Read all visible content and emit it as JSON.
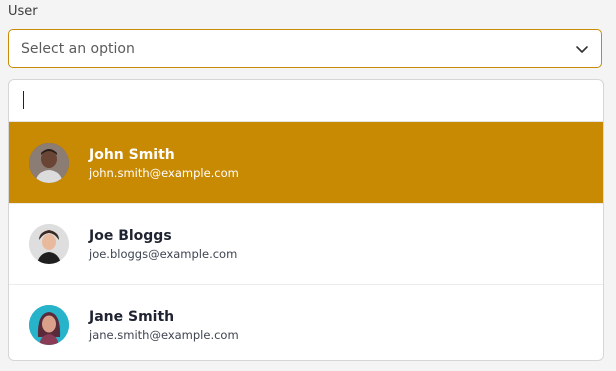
{
  "field": {
    "label": "User",
    "placeholder": "Select an option"
  },
  "search": {
    "value": ""
  },
  "options": [
    {
      "name": "John Smith",
      "email": "john.smith@example.com",
      "avatar": "avatar-john",
      "selected": true
    },
    {
      "name": "Joe Bloggs",
      "email": "joe.bloggs@example.com",
      "avatar": "avatar-joe",
      "selected": false
    },
    {
      "name": "Jane Smith",
      "email": "jane.smith@example.com",
      "avatar": "avatar-jane",
      "selected": false
    }
  ],
  "colors": {
    "accent": "#c98a03",
    "border": "#d6d6d6"
  }
}
